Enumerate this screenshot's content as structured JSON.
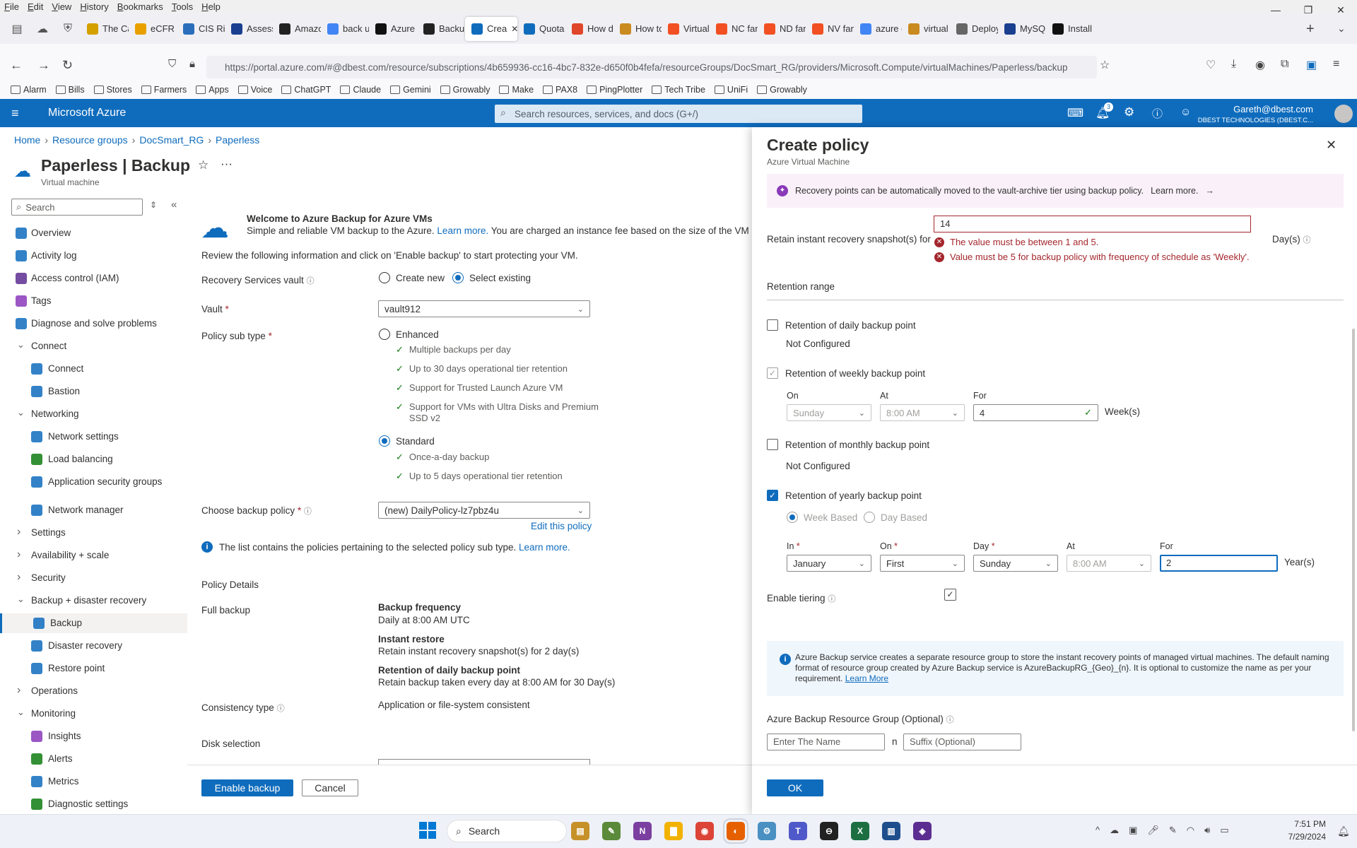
{
  "menubar": {
    "items": [
      "File",
      "Edit",
      "View",
      "History",
      "Bookmarks",
      "Tools",
      "Help"
    ]
  },
  "tabs": [
    {
      "label": "The Ca",
      "color": "#d4a000"
    },
    {
      "label": "eCFR ::",
      "color": "#e8a000"
    },
    {
      "label": "CIS Risl",
      "color": "#2a6ebb"
    },
    {
      "label": "Assess",
      "color": "#1b3f8f"
    },
    {
      "label": "Amazo",
      "color": "#222"
    },
    {
      "label": "back u",
      "color": "#4285f4"
    },
    {
      "label": "Azure I",
      "color": "#111"
    },
    {
      "label": "Backup",
      "color": "#222"
    },
    {
      "label": "Crea",
      "color": "#0f6cbd",
      "active": true
    },
    {
      "label": "Quota",
      "color": "#0f6cbd"
    },
    {
      "label": "How d",
      "color": "#e0462a"
    },
    {
      "label": "How to",
      "color": "#c98a20"
    },
    {
      "label": "Virtual",
      "color": "#f25022"
    },
    {
      "label": "NC fan",
      "color": "#f25022"
    },
    {
      "label": "ND fan",
      "color": "#f25022"
    },
    {
      "label": "NV fan",
      "color": "#f25022"
    },
    {
      "label": "azure g",
      "color": "#4285f4"
    },
    {
      "label": "virtual",
      "color": "#c98a20"
    },
    {
      "label": "Deploy",
      "color": "#666"
    },
    {
      "label": "MySQL",
      "color": "#1b3f8f"
    },
    {
      "label": "Install I",
      "color": "#111"
    }
  ],
  "url": "https://portal.azure.com/#@dbest.com/resource/subscriptions/4b659936-cc16-4bc7-832e-d650f0b4fefa/resourceGroups/DocSmart_RG/providers/Microsoft.Compute/virtualMachines/Paperless/backup",
  "bookmarks": [
    "Alarm",
    "Bills",
    "Stores",
    "Farmers",
    "Apps",
    "Voice",
    "ChatGPT",
    "Claude",
    "Gemini",
    "Growably",
    "Make",
    "PAX8",
    "PingPlotter",
    "Tech Tribe",
    "UniFi",
    "Growably"
  ],
  "azure": {
    "brand": "Microsoft Azure",
    "search_placeholder": "Search resources, services, and docs (G+/)",
    "notif_count": "3",
    "user_email": "Gareth@dbest.com",
    "user_org": "DBEST TECHNOLOGIES (DBEST.C..."
  },
  "breadcrumb": [
    "Home",
    "Resource groups",
    "DocSmart_RG",
    "Paperless"
  ],
  "page": {
    "title": "Paperless | Backup",
    "subtitle": "Virtual machine"
  },
  "leftnav": {
    "search_placeholder": "Search",
    "items": [
      {
        "label": "Overview",
        "type": "item"
      },
      {
        "label": "Activity log",
        "type": "item"
      },
      {
        "label": "Access control (IAM)",
        "type": "item"
      },
      {
        "label": "Tags",
        "type": "item"
      },
      {
        "label": "Diagnose and solve problems",
        "type": "item"
      },
      {
        "label": "Connect",
        "type": "group"
      },
      {
        "label": "Connect",
        "type": "sub"
      },
      {
        "label": "Bastion",
        "type": "sub"
      },
      {
        "label": "Networking",
        "type": "group"
      },
      {
        "label": "Network settings",
        "type": "sub"
      },
      {
        "label": "Load balancing",
        "type": "sub"
      },
      {
        "label": "Application security groups",
        "type": "sub"
      },
      {
        "label": "Network manager",
        "type": "sub"
      },
      {
        "label": "Settings",
        "type": "groupc"
      },
      {
        "label": "Availability + scale",
        "type": "groupc"
      },
      {
        "label": "Security",
        "type": "groupc"
      },
      {
        "label": "Backup + disaster recovery",
        "type": "group"
      },
      {
        "label": "Backup",
        "type": "sub",
        "active": true
      },
      {
        "label": "Disaster recovery",
        "type": "sub"
      },
      {
        "label": "Restore point",
        "type": "sub"
      },
      {
        "label": "Operations",
        "type": "groupc"
      },
      {
        "label": "Monitoring",
        "type": "group"
      },
      {
        "label": "Insights",
        "type": "sub"
      },
      {
        "label": "Alerts",
        "type": "sub"
      },
      {
        "label": "Metrics",
        "type": "sub"
      },
      {
        "label": "Diagnostic settings",
        "type": "sub"
      }
    ]
  },
  "main": {
    "welcome_title": "Welcome to Azure Backup for Azure VMs",
    "welcome_text": "Simple and reliable VM backup to the Azure.",
    "welcome_link": "Learn more.",
    "welcome_text2": "You are charged an instance fee based on the size of the VM and",
    "review_text": "Review the following information and click on 'Enable backup' to start protecting your VM.",
    "vault_label": "Recovery Services vault",
    "create_new": "Create new",
    "select_existing": "Select existing",
    "vault_field_label": "Vault",
    "vault_value": "vault912",
    "policy_subtype_label": "Policy sub type",
    "enhanced": "Enhanced",
    "enhanced_features": [
      "Multiple backups per day",
      "Up to 30 days operational tier retention",
      "Support for Trusted Launch Azure VM",
      "Support for VMs with Ultra Disks and Premium SSD v2"
    ],
    "standard": "Standard",
    "standard_features": [
      "Once-a-day backup",
      "Up to 5 days operational tier retention"
    ],
    "choose_policy_label": "Choose backup policy",
    "policy_value": "(new) DailyPolicy-lz7pbz4u",
    "edit_policy": "Edit this policy",
    "info_text": "The list contains the policies pertaining to the selected policy sub type.",
    "info_link": "Learn more.",
    "policy_details": "Policy Details",
    "full_backup": "Full backup",
    "backup_frequency_title": "Backup frequency",
    "backup_frequency_value": "Daily at 8:00 AM UTC",
    "instant_restore_title": "Instant restore",
    "instant_restore_value": "Retain instant recovery snapshot(s) for 2 day(s)",
    "daily_retention_title": "Retention of daily backup point",
    "daily_retention_value": "Retain backup taken every day at 8:00 AM for 30 Day(s)",
    "consistency_label": "Consistency type",
    "consistency_value": "Application or file-system consistent",
    "disk_selection": "Disk selection",
    "enable_backup": "Enable backup",
    "cancel": "Cancel"
  },
  "panel": {
    "title": "Create policy",
    "subtitle": "Azure Virtual Machine",
    "banner": "Recovery points can be automatically moved to the vault-archive tier using backup policy.",
    "banner_link": "Learn more.",
    "snapshot_label": "Retain instant recovery snapshot(s) for",
    "snapshot_value": "14",
    "snapshot_unit": "Day(s)",
    "error1": "The value must be between 1 and 5.",
    "error2": "Value must be 5 for backup policy with frequency of schedule as 'Weekly'.",
    "retention_range": "Retention range",
    "daily_label": "Retention of daily backup point",
    "daily_status": "Not Configured",
    "weekly_label": "Retention of weekly backup point",
    "weekly_on_label": "On",
    "weekly_on": "Sunday",
    "weekly_at_label": "At",
    "weekly_at": "8:00 AM",
    "weekly_for_label": "For",
    "weekly_for": "4",
    "weekly_unit": "Week(s)",
    "monthly_label": "Retention of monthly backup point",
    "monthly_status": "Not Configured",
    "yearly_label": "Retention of yearly backup point",
    "week_based": "Week Based",
    "day_based": "Day Based",
    "in_label": "In",
    "in_value": "January",
    "on_label": "On",
    "on_value": "First",
    "day_label": "Day",
    "day_value": "Sunday",
    "at_label": "At",
    "at_value": "8:00 AM",
    "for_label": "For",
    "for_value": "2",
    "year_unit": "Year(s)",
    "tiering_label": "Enable tiering",
    "info_box": "Azure Backup service creates a separate resource group to store the instant recovery points of managed virtual machines. The default naming format of resource group created by Azure Backup service is AzureBackupRG_{Geo}_{n}. It is optional to customize the name as per your requirement.",
    "info_box_link": "Learn More",
    "rg_label": "Azure Backup Resource Group (Optional)",
    "rg_name_placeholder": "Enter The Name",
    "rg_n": "n",
    "rg_suffix_placeholder": "Suffix (Optional)",
    "ok": "OK"
  },
  "taskbar": {
    "search": "Search",
    "time": "7:51 PM",
    "date": "7/29/2024"
  }
}
